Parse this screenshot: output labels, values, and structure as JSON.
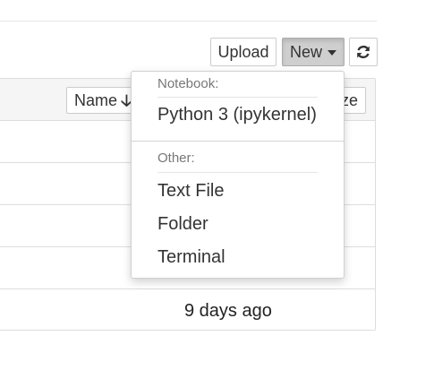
{
  "toolbar": {
    "upload_label": "Upload",
    "new_label": "New",
    "refresh_icon": "refresh-icon"
  },
  "file_list": {
    "sort_name_label": "Name",
    "sort_name_icon": "arrow-down-icon",
    "sort_size_label": "ze",
    "last_row_modified": "9 days ago"
  },
  "new_menu": {
    "notebook_header": "Notebook:",
    "notebook_items": [
      "Python 3 (ipykernel)"
    ],
    "other_header": "Other:",
    "other_items": [
      "Text File",
      "Folder",
      "Terminal"
    ]
  },
  "colors": {
    "new_button_active": "#cfcfcf",
    "list_header_bg": "#f5f5f5",
    "border": "#dddddd"
  }
}
